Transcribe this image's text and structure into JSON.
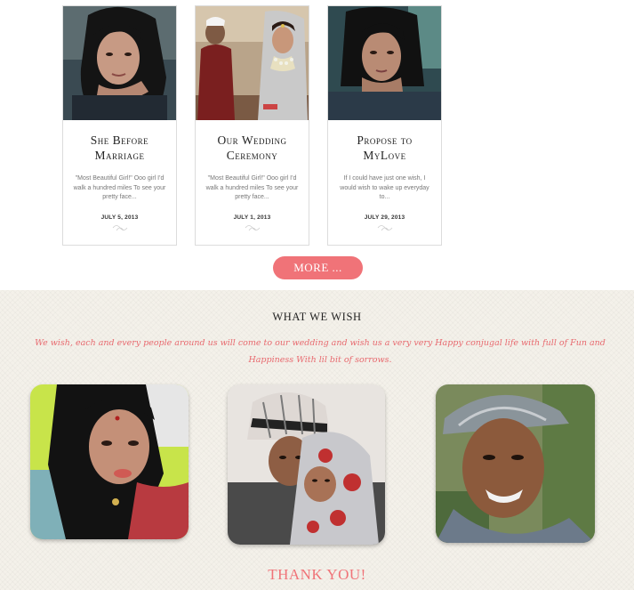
{
  "posts": [
    {
      "title_line1": "She Before",
      "title_line2": "Marriage",
      "excerpt": "\"Most Beautiful Girl!\" Ooo girl I'd walk a hundred miles To see your pretty face...",
      "date": "JULY 5, 2013",
      "image": "portrait of a girl resting chin on hand"
    },
    {
      "title_line1": "Our Wedding",
      "title_line2": "Ceremony",
      "excerpt": "\"Most Beautiful Girl!\" Ooo girl I'd walk a hundred miles To see your pretty face...",
      "date": "JULY 1, 2013",
      "image": "bride and groom seated together"
    },
    {
      "title_line1": "Propose to",
      "title_line2": "MyLove",
      "excerpt": "If I could have just one wish, I would wish to wake up everyday to...",
      "date": "JULY 29, 2013",
      "image": "girl looking at camera"
    }
  ],
  "more_button": "MORE ...",
  "wish": {
    "heading": "WHAT WE WISH",
    "message": "We wish, each and every people around us will come to our wedding and wish us a very very Happy conjugal life with full of Fun and Happiness With lil bit of sorrows.",
    "photos": [
      "selfie of the bride",
      "couple selfie",
      "portrait of the groom"
    ]
  },
  "thanks": "THANK YOU!",
  "colors": {
    "accent": "#f07378",
    "script": "#e86a6f",
    "wish_bg": "#f4f1ea"
  }
}
